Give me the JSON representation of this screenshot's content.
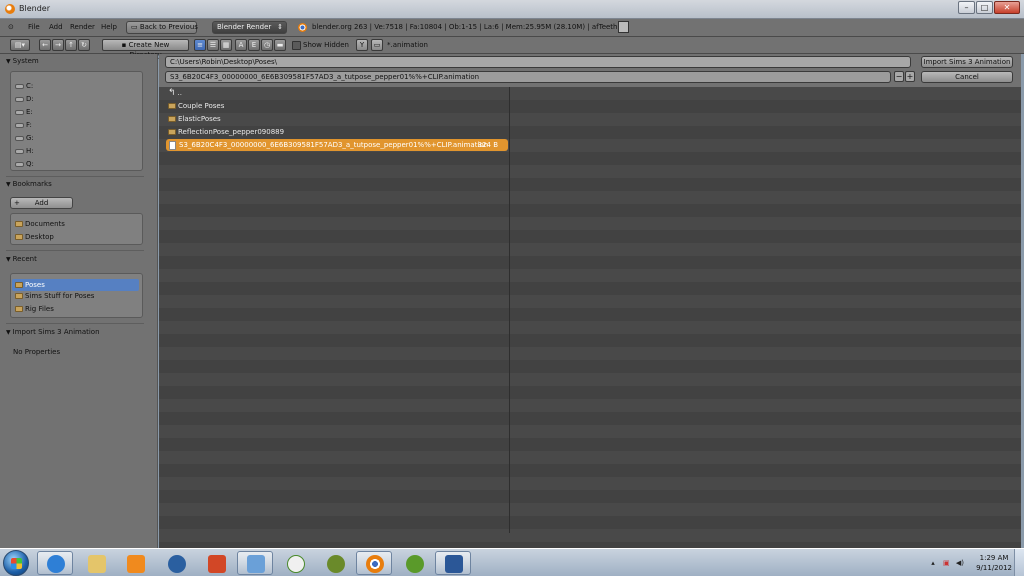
{
  "window": {
    "title": "Blender",
    "minimize": "–",
    "maximize": "□",
    "close": "✕"
  },
  "infobar": {
    "menus": [
      "File",
      "Add",
      "Render",
      "Help"
    ],
    "back_button": "Back to Previous",
    "engine": "Blender Render",
    "engine_arrow": "⇕",
    "stats": "blender.org 263 | Ve:7518 | Fa:10804 | Ob:1-15 | La:6 | Mem:25.95M (28.10M) | afTeeth"
  },
  "fbheader": {
    "create_dir_button": "Create New Directory",
    "show_hidden_label": "Show Hidden",
    "filter_text": "*.animation"
  },
  "sidebar": {
    "system_header": "System",
    "drives": [
      "C:",
      "D:",
      "E:",
      "F:",
      "G:",
      "H:",
      "Q:"
    ],
    "bookmarks_header": "Bookmarks",
    "add_button": "Add",
    "bookmarks": [
      "Documents",
      "Desktop"
    ],
    "recent_header": "Recent",
    "recent": [
      "Poses",
      "Sims Stuff for Poses",
      "Rig Files"
    ],
    "operator_header": "Import Sims 3 Animation",
    "no_properties": "No Properties"
  },
  "browser": {
    "path": "C:\\Users\\Robin\\Desktop\\Poses\\",
    "filename": "S3_6B20C4F3_00000000_6E6B309581F57AD3_a_tutpose_pepper01%%+CLIP.animation",
    "import_button": "Import Sims 3 Animation",
    "cancel_button": "Cancel",
    "minus": "−",
    "plus": "+",
    "parent_dir": "..",
    "entries": [
      {
        "name": "Couple Poses",
        "type": "folder"
      },
      {
        "name": "ElasticPoses",
        "type": "folder"
      },
      {
        "name": "ReflectionPose_pepper090889",
        "type": "folder"
      },
      {
        "name": "S3_6B20C4F3_00000000_6E6B309581F57AD3_a_tutpose_pepper01%%+CLIP.animation",
        "type": "file",
        "size": "324 B",
        "selected": true
      }
    ]
  },
  "taskbar": {
    "apps": [
      "start",
      "internet-explorer",
      "file-explorer",
      "media-player",
      "globe",
      "powerpoint",
      "paint",
      "talk",
      "gimp",
      "blender",
      "gimp-alt",
      "word"
    ],
    "clock_time": "1:29 AM",
    "clock_date": "9/11/2012",
    "colors": {
      "ie": "#2e7fd6",
      "explorer": "#e4c56a",
      "media": "#f08a1e",
      "globe": "#2a5fa0",
      "ppt": "#d24726",
      "paint": "#6aa0d8",
      "talk": "#f0f0f0",
      "gimp": "#6a8a2a",
      "blender": "#e87d0d",
      "word": "#2b5797"
    }
  }
}
